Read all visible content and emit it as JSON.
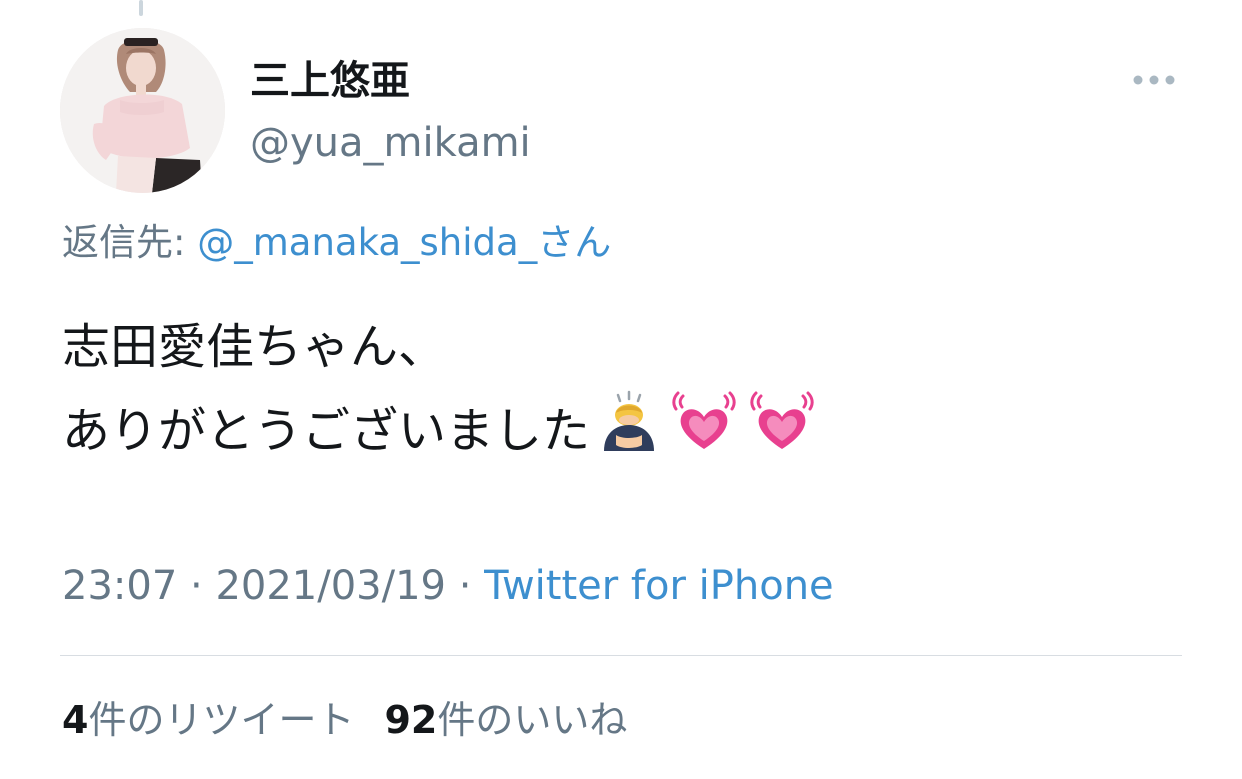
{
  "tweet": {
    "display_name": "三上悠亜",
    "handle": "@yua_mikami",
    "reply_prefix": "返信先: ",
    "reply_mention": "@_manaka_shida_さん",
    "text_line1": "志田愛佳ちゃん、",
    "text_line2": "ありがとうございました",
    "emojis": [
      "person-bowing-emoji",
      "beating-heart-emoji",
      "beating-heart-emoji"
    ],
    "time": "23:07",
    "date": "2021/03/19",
    "separator": " · ",
    "source": "Twitter for iPhone"
  },
  "stats": {
    "retweet_count": "4",
    "retweet_label": "件のリツイート",
    "like_count": "92",
    "like_label": "件のいいね"
  },
  "colors": {
    "link": "#3d8fcf",
    "secondary_text": "#657786",
    "primary_text": "#14171a",
    "heart": "#e8408f"
  }
}
